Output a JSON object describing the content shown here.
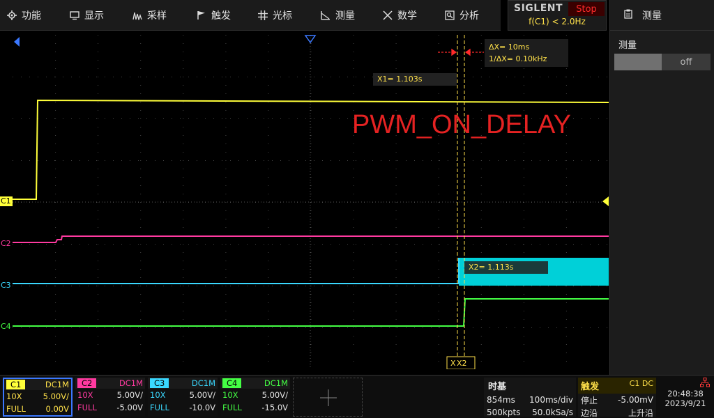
{
  "menu": {
    "items": [
      {
        "label": "功能",
        "icon": "gear-icon"
      },
      {
        "label": "显示",
        "icon": "monitor-icon"
      },
      {
        "label": "采样",
        "icon": "sampling-icon"
      },
      {
        "label": "触发",
        "icon": "flag-icon"
      },
      {
        "label": "光标",
        "icon": "crosshair-icon"
      },
      {
        "label": "测量",
        "icon": "measure-icon"
      },
      {
        "label": "数学",
        "icon": "math-icon"
      },
      {
        "label": "分析",
        "icon": "analysis-icon"
      }
    ]
  },
  "brand": {
    "logo": "SIGLENT",
    "run_state": "Stop",
    "trigger_freq": "f(C1) < 2.0Hz"
  },
  "right_panel": {
    "title": "测量",
    "section_label": "测量",
    "toggle_value": "off"
  },
  "channels": {
    "c1": {
      "label": "C1",
      "color": "#ffff3a"
    },
    "c2": {
      "label": "C2",
      "color": "#ff3aa0"
    },
    "c3": {
      "label": "C3",
      "color": "#3ad8ff"
    },
    "c4": {
      "label": "C4",
      "color": "#44ff44"
    }
  },
  "cursors": {
    "delta_x": "ΔX= 10ms",
    "inv_delta_x": "1/ΔX= 0.10kHz",
    "x1": "X1= 1.103s",
    "x2": "X2= 1.113s",
    "x2_marker": "X2",
    "x_marker": "X"
  },
  "annotation": "PWM_ON_DELAY",
  "bottom": {
    "ch1": {
      "name": "C1",
      "coupling": "DC1M",
      "probe": "10X",
      "scale": "5.00V/",
      "bw": "FULL",
      "offset": "0.00V"
    },
    "ch2": {
      "name": "C2",
      "coupling": "DC1M",
      "probe": "10X",
      "scale": "5.00V/",
      "bw": "FULL",
      "offset": "-5.00V"
    },
    "ch3": {
      "name": "C3",
      "coupling": "DC1M",
      "probe": "10X",
      "scale": "5.00V/",
      "bw": "FULL",
      "offset": "-10.0V"
    },
    "ch4": {
      "name": "C4",
      "coupling": "DC1M",
      "probe": "10X",
      "scale": "5.00V/",
      "bw": "FULL",
      "offset": "-15.0V"
    },
    "timebase": {
      "title": "时基",
      "delay": "854ms",
      "scale": "100ms/div",
      "memory": "500kpts",
      "rate": "50.0kSa/s"
    },
    "trigger": {
      "title": "触发",
      "source": "C1 DC",
      "mode": "停止",
      "level": "-5.00mV",
      "type": "边沿",
      "slope": "上升沿"
    },
    "clock": {
      "time": "20:48:38",
      "date": "2023/9/21"
    }
  }
}
